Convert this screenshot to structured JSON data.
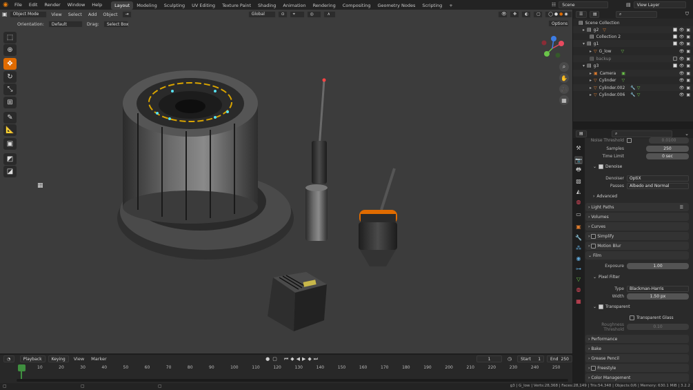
{
  "topbar": {
    "menus": [
      "File",
      "Edit",
      "Render",
      "Window",
      "Help"
    ],
    "workspaces": [
      "Layout",
      "Modeling",
      "Sculpting",
      "UV Editing",
      "Texture Paint",
      "Shading",
      "Animation",
      "Rendering",
      "Compositing",
      "Geometry Nodes",
      "Scripting"
    ],
    "active_workspace": "Layout",
    "scene": "Scene",
    "view_layer": "View Layer",
    "add_tab": "+"
  },
  "viewport": {
    "mode": "Object Mode",
    "menus": [
      "View",
      "Select",
      "Add",
      "Object"
    ],
    "transform": "Global",
    "orientation_label": "Orientation:",
    "orientation_value": "Default",
    "drag_label": "Drag:",
    "drag_value": "Select Box",
    "options": "Options"
  },
  "outliner": {
    "items": [
      {
        "label": "Scene Collection",
        "indent": 0
      },
      {
        "label": "g2",
        "indent": 1
      },
      {
        "label": "Collection 2",
        "indent": 1
      },
      {
        "label": "g1",
        "indent": 1
      },
      {
        "label": "G_low",
        "indent": 2
      },
      {
        "label": "backup",
        "indent": 1
      },
      {
        "label": "g3",
        "indent": 1
      },
      {
        "label": "Camera",
        "indent": 2
      },
      {
        "label": "Cylinder",
        "indent": 2
      },
      {
        "label": "Cylinder.002",
        "indent": 2
      },
      {
        "label": "Cylinder.006",
        "indent": 2
      }
    ]
  },
  "properties": {
    "noise_threshold_label": "Noise Threshold",
    "noise_threshold_value": "0.0100",
    "samples_label": "Samples",
    "samples_value": "250",
    "time_limit_label": "Time Limit",
    "time_limit_value": "0 sec",
    "denoise_label": "Denoise",
    "denoiser_label": "Denoiser",
    "denoiser_value": "OptiX",
    "passes_label": "Passes",
    "passes_value": "Albedo and Normal",
    "advanced_label": "Advanced",
    "light_paths_label": "Light Paths",
    "volumes_label": "Volumes",
    "curves_label": "Curves",
    "simplify_label": "Simplify",
    "motion_blur_label": "Motion Blur",
    "film_label": "Film",
    "exposure_label": "Exposure",
    "exposure_value": "1.00",
    "pixel_filter_label": "Pixel Filter",
    "type_label": "Type",
    "type_value": "Blackman-Harris",
    "width_label": "Width",
    "width_value": "1.50 px",
    "transparent_label": "Transparent",
    "transparent_glass_label": "Transparent Glass",
    "roughness_label": "Roughness Threshold",
    "roughness_value": "0.10",
    "performance_label": "Performance",
    "bake_label": "Bake",
    "grease_pencil_label": "Grease Pencil",
    "freestyle_label": "Freestyle",
    "color_management_label": "Color Management"
  },
  "timeline": {
    "menus": [
      "Playback",
      "Keying",
      "View",
      "Marker"
    ],
    "current_frame": "1",
    "start_label": "Start",
    "start_value": "1",
    "end_label": "End",
    "end_value": "250",
    "ruler": [
      "1",
      "10",
      "20",
      "30",
      "40",
      "50",
      "60",
      "70",
      "80",
      "90",
      "100",
      "110",
      "120",
      "130",
      "140",
      "150",
      "160",
      "170",
      "180",
      "190",
      "200",
      "210",
      "220",
      "230",
      "240",
      "250"
    ]
  },
  "statusbar": {
    "stats": "g3 | G_low | Verts:28,368 | Faces:28,149 | Tris:54,348 | Objects:0/6 | Memory: 630.1 MiB | 3.2.2"
  },
  "colors": {
    "accent": "#e06b00",
    "viewport_bg": "#3c3c3c",
    "panel_bg": "#2a2a2a"
  }
}
